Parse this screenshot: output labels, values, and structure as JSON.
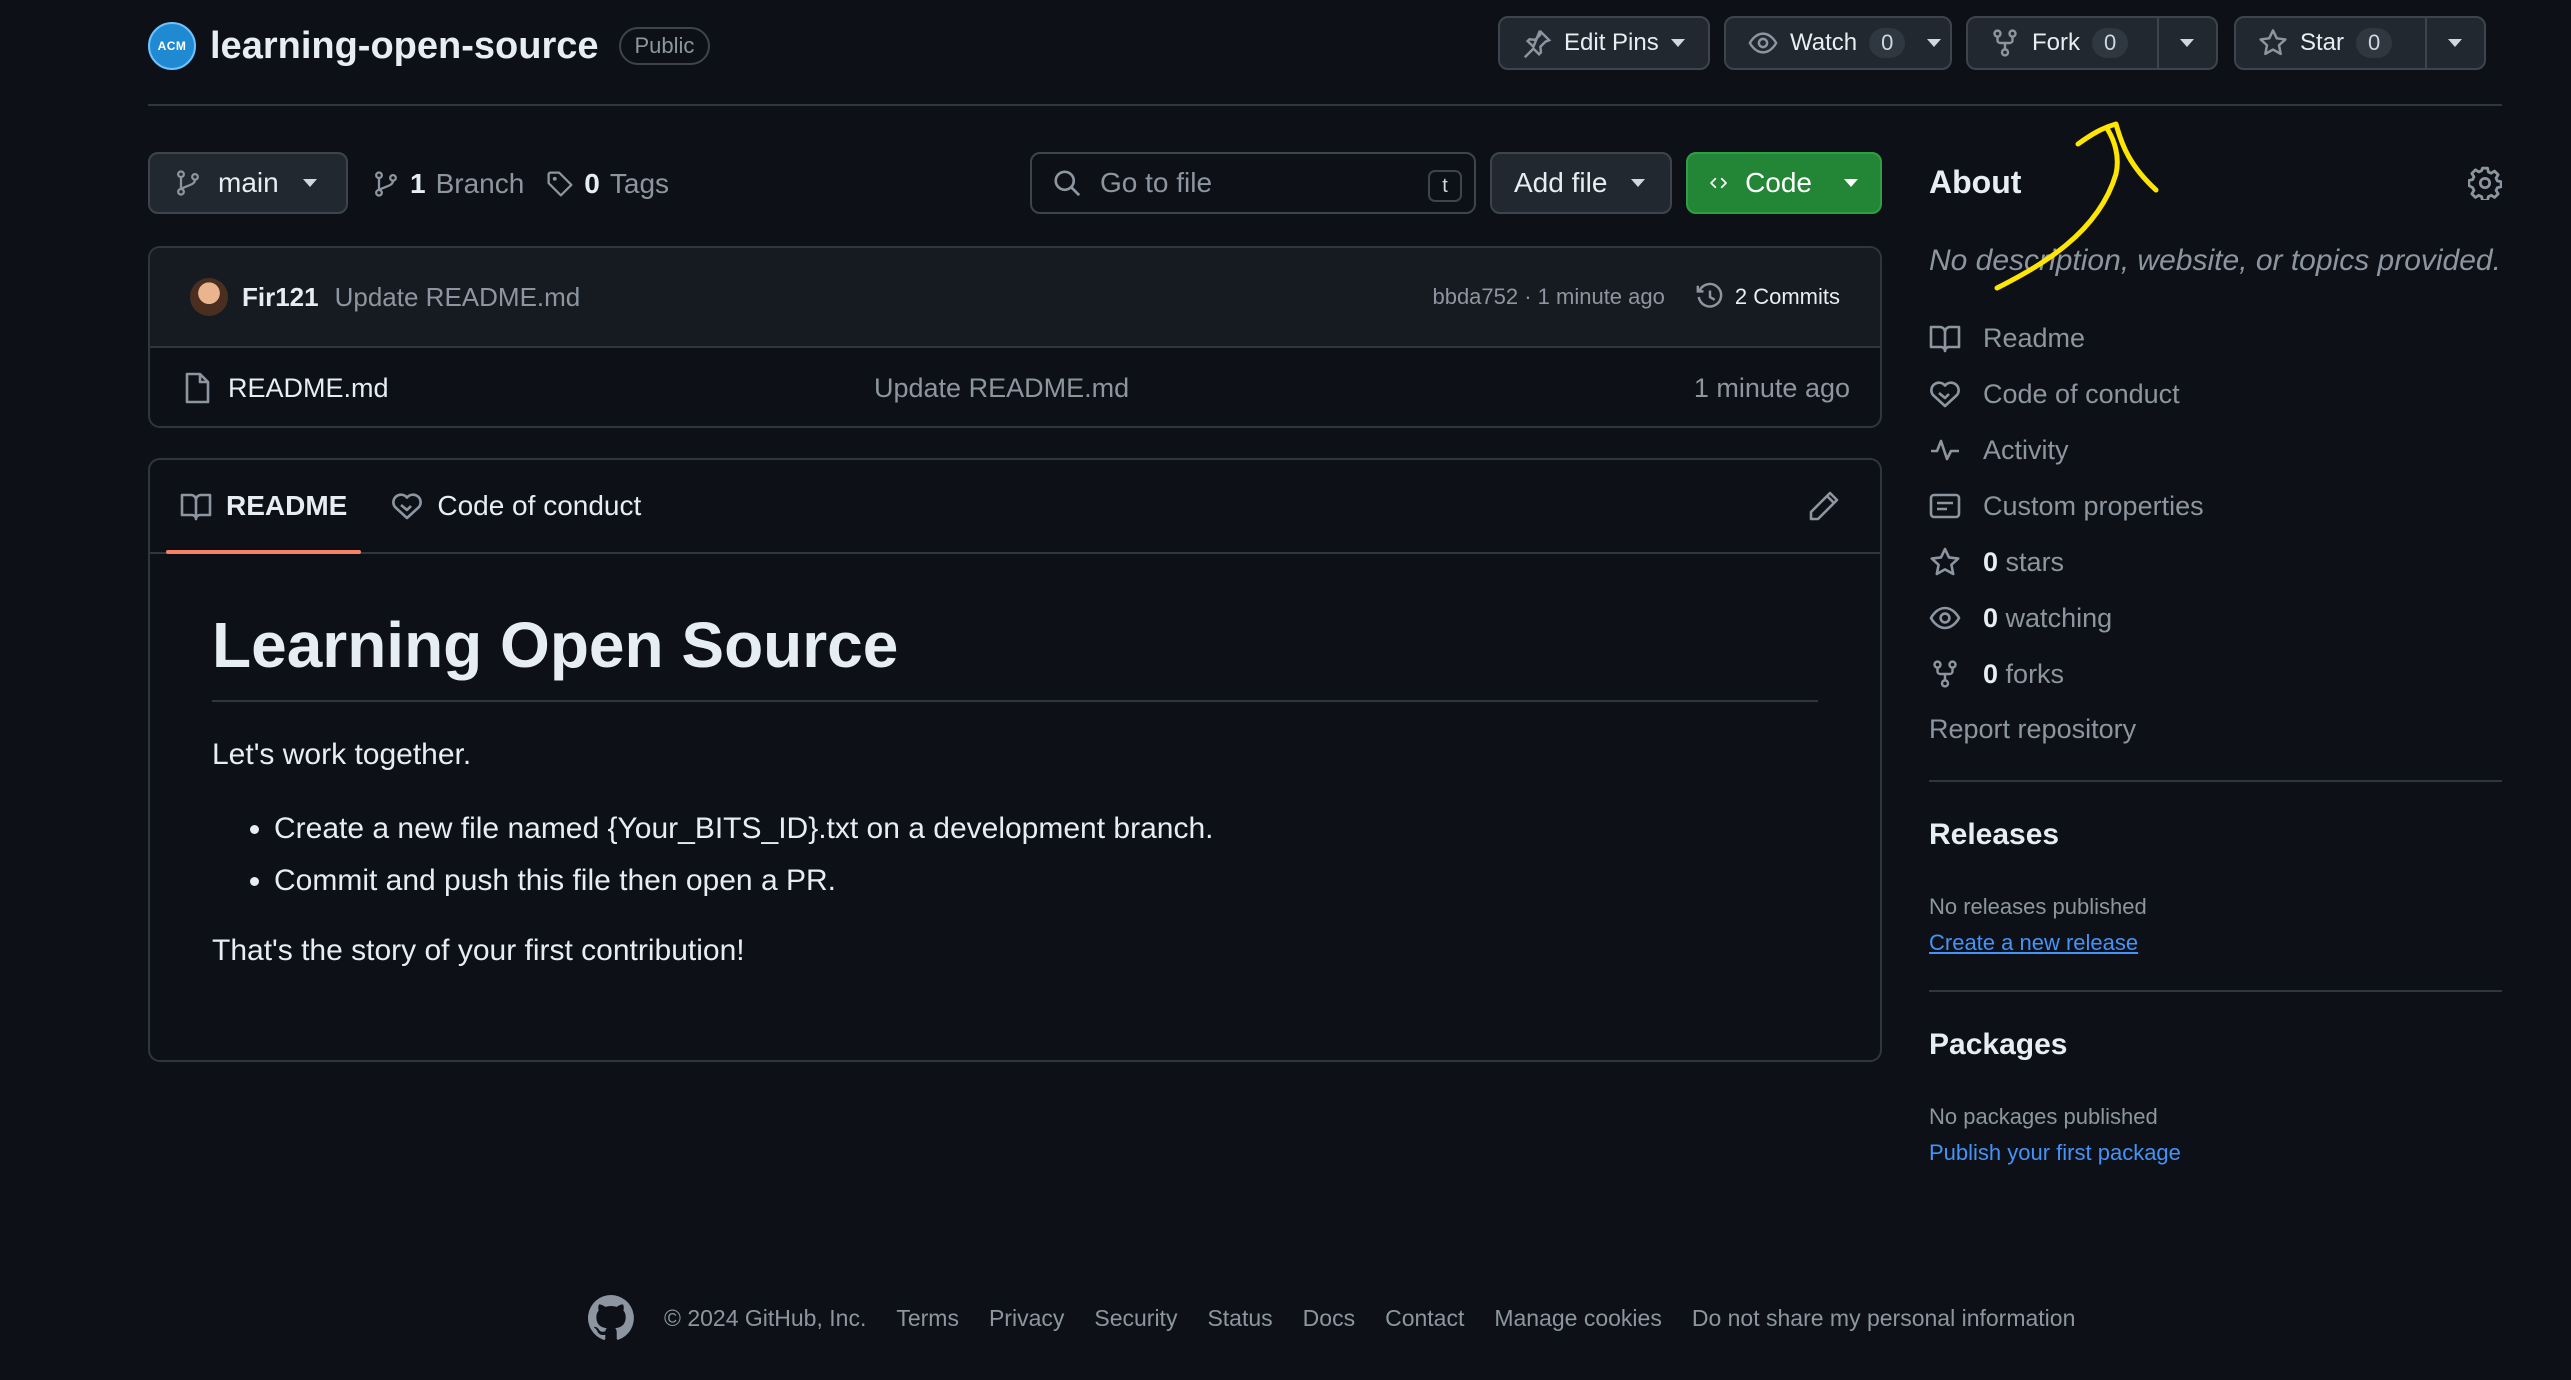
{
  "repo": {
    "org_logo_text": "ACM",
    "name": "learning-open-source",
    "visibility": "Public"
  },
  "header_buttons": {
    "edit_pins": "Edit Pins",
    "watch": "Watch",
    "watch_count": "0",
    "fork": "Fork",
    "fork_count": "0",
    "star": "Star",
    "star_count": "0"
  },
  "toolbar": {
    "branch": "main",
    "branch_count": "1",
    "branch_label": "Branch",
    "tag_count": "0",
    "tag_label": "Tags",
    "goto_placeholder": "Go to file",
    "goto_key": "t",
    "add_file": "Add file",
    "code": "Code"
  },
  "latest_commit": {
    "author": "Fir121",
    "message": "Update README.md",
    "meta": "bbda752 · 1 minute ago",
    "commits": "2 Commits"
  },
  "files": [
    {
      "name": "README.md",
      "message": "Update README.md",
      "time": "1 minute ago"
    }
  ],
  "readme": {
    "tabs": [
      "README",
      "Code of conduct"
    ],
    "heading": "Learning Open Source",
    "intro": "Let's work together.",
    "bullets": [
      "Create a new file named {Your_BITS_ID}.txt on a development branch.",
      "Commit and push this file then open a PR."
    ],
    "outro": "That's the story of your first contribution!"
  },
  "sidebar": {
    "about_title": "About",
    "description": "No description, website, or topics provided.",
    "items": {
      "readme": "Readme",
      "code_of_conduct": "Code of conduct",
      "activity": "Activity",
      "custom_properties": "Custom properties",
      "stars_count": "0",
      "stars_label": "stars",
      "watching_count": "0",
      "watching_label": "watching",
      "forks_count": "0",
      "forks_label": "forks"
    },
    "report": "Report repository",
    "releases": {
      "title": "Releases",
      "none": "No releases published",
      "link": "Create a new release"
    },
    "packages": {
      "title": "Packages",
      "none": "No packages published",
      "link": "Publish your first package"
    }
  },
  "footer": {
    "copyright": "© 2024 GitHub, Inc.",
    "links": [
      "Terms",
      "Privacy",
      "Security",
      "Status",
      "Docs",
      "Contact",
      "Manage cookies",
      "Do not share my personal information"
    ]
  },
  "colors": {
    "background": "#0d1117",
    "code_button": "#238636",
    "link": "#4493f8",
    "active_tab": "#f78166",
    "annotation": "#ffe600"
  }
}
